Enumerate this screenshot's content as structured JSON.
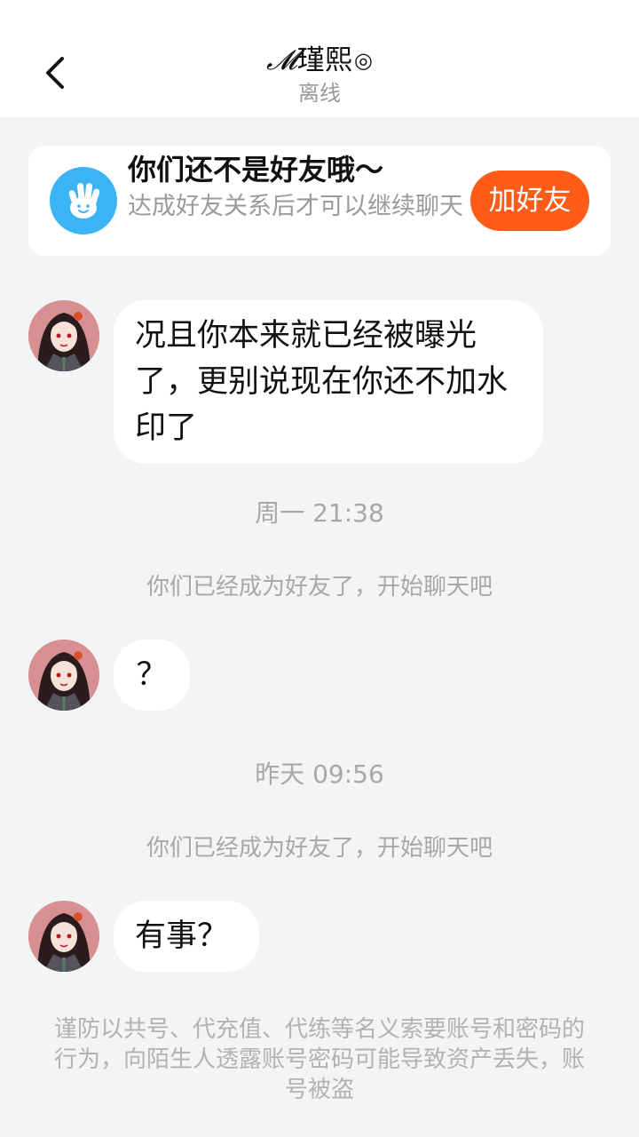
{
  "header": {
    "title_prefix": "𝓜",
    "title_name": "瑾熙",
    "title_suffix": "◎",
    "status": "离线"
  },
  "friend_card": {
    "title": "你们还不是好友哦～",
    "desc": "达成好友关系后才可以继续聊天",
    "button": "加好友",
    "icon": "waving-hand-icon",
    "accent": "#ff5c18",
    "icon_bg": "#3ab4f5"
  },
  "messages": [
    {
      "type": "incoming",
      "text": "况且你本来就已经被曝光了，更别说现在你还不加水印了"
    },
    {
      "type": "timestamp",
      "text": "周一 21:38"
    },
    {
      "type": "system",
      "text": "你们已经成为好友了，开始聊天吧"
    },
    {
      "type": "incoming",
      "text": "？"
    },
    {
      "type": "timestamp",
      "text": "昨天 09:56"
    },
    {
      "type": "system",
      "text": "你们已经成为好友了，开始聊天吧"
    },
    {
      "type": "incoming",
      "text": "有事？"
    }
  ],
  "warning": "谨防以共号、代充值、代练等名义索要账号和密码的行为，向陌生人透露账号密码可能导致资产丢失，账号被盗"
}
